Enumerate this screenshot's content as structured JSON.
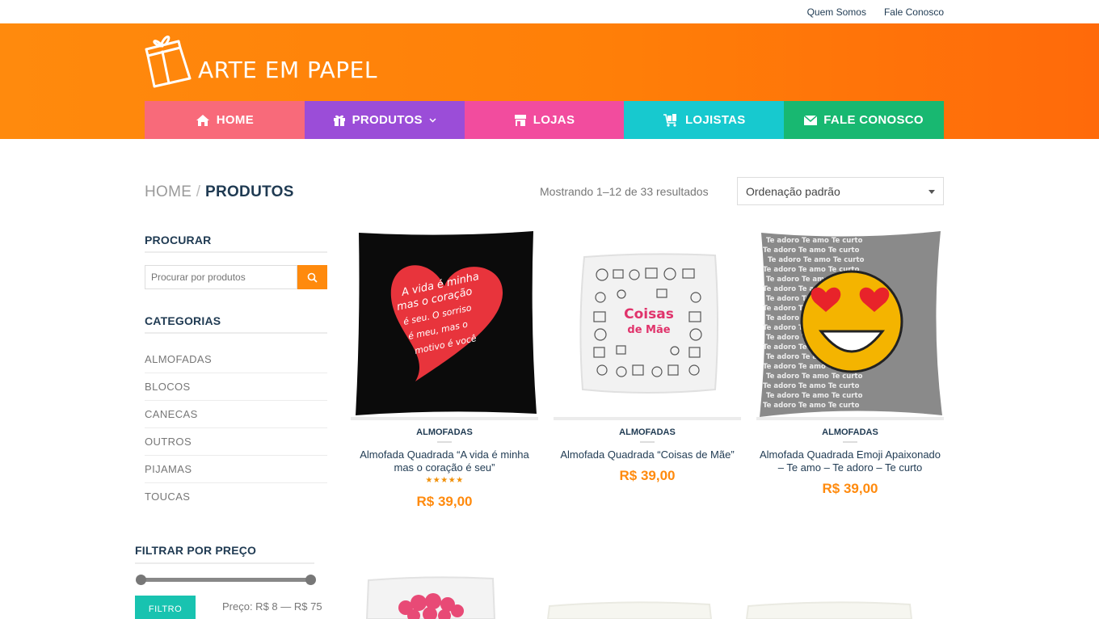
{
  "topbar": {
    "links": [
      "Quem Somos",
      "Fale Conosco"
    ]
  },
  "brand": {
    "name": "ARTE EM PAPEL"
  },
  "nav": {
    "items": [
      {
        "label": "HOME",
        "icon": "home-icon"
      },
      {
        "label": "PRODUTOS",
        "icon": "gift-icon"
      },
      {
        "label": "LOJAS",
        "icon": "store-icon"
      },
      {
        "label": "LOJISTAS",
        "icon": "cart-icon"
      },
      {
        "label": "FALE CONOSCO",
        "icon": "envelope-icon"
      }
    ]
  },
  "breadcrumb": {
    "home": "HOME",
    "separator": "/",
    "current": "PRODUTOS"
  },
  "results": {
    "text": "Mostrando 1–12 de 33 resultados"
  },
  "orderby": {
    "selected": "Ordenação padrão"
  },
  "sidebar": {
    "search_title": "PROCURAR",
    "search_placeholder": "Procurar por produtos",
    "categories_title": "CATEGORIAS",
    "categories": [
      "ALMOFADAS",
      "BLOCOS",
      "CANECAS",
      "OUTROS",
      "PIJAMAS",
      "TOUCAS"
    ],
    "price_title": "FILTRAR POR PREÇO",
    "filter_button": "FILTRO",
    "price_range": "Preço: R$ 8 — R$ 75"
  },
  "products": [
    {
      "category": "ALMOFADAS",
      "name_line1": "Almofada Quadrada “A vida é minha",
      "name_line2": "mas o coração é seu”",
      "rating": 5,
      "stars": "★★★★★",
      "price": "R$ 39,00",
      "image_text": [
        "A vida é minha",
        "mas o coração",
        "é seu. O sorriso",
        "é meu, mas o",
        "motivo é você"
      ]
    },
    {
      "category": "ALMOFADAS",
      "name_line1": "Almofada Quadrada “Coisas de Mãe”",
      "name_line2": "",
      "price": "R$ 39,00",
      "image_text": [
        "Coisas",
        "de Mãe"
      ]
    },
    {
      "category": "ALMOFADAS",
      "name_line1": "Almofada Quadrada Emoji Apaixonado",
      "name_line2": "– Te amo – Te adoro – Te curto",
      "price": "R$ 39,00",
      "image_text": [
        "Te adoro Te amo Te curto"
      ]
    }
  ],
  "colors": {
    "header_orange": "#ff8a0d",
    "nav_home": "#f86a7a",
    "nav_produtos": "#9b4dd8",
    "nav_lojas": "#f24c9e",
    "nav_lojistas": "#17c9cf",
    "nav_fale": "#18b871",
    "price_orange": "#ff8a0d",
    "title_navy": "#1f3a52",
    "filter_teal": "#18c3b0"
  }
}
